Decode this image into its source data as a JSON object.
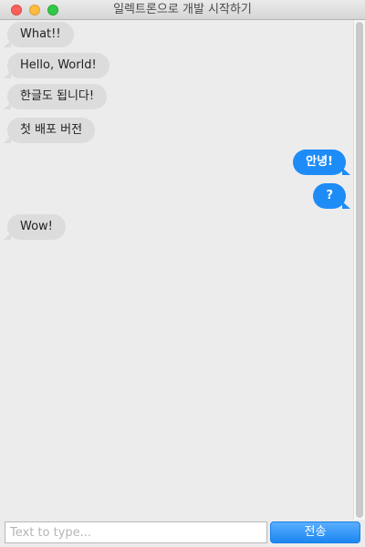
{
  "window": {
    "title": "일렉트론으로 개발 시작하기"
  },
  "messages": [
    {
      "direction": "received",
      "text": "What!!"
    },
    {
      "direction": "received",
      "text": "Hello, World!"
    },
    {
      "direction": "received",
      "text": "한글도 됩니다!"
    },
    {
      "direction": "received",
      "text": "첫 배포 버전"
    },
    {
      "direction": "sent",
      "text": "안녕!"
    },
    {
      "direction": "sent",
      "text": "?"
    },
    {
      "direction": "received",
      "text": "Wow!"
    }
  ],
  "composer": {
    "placeholder": "Text to type...",
    "value": "",
    "send_label": "전송"
  },
  "colors": {
    "sent_bubble": "#1e8cf7",
    "received_bubble": "#dcdcdc",
    "close": "#fc605c",
    "minimize": "#fdbc40",
    "maximize": "#34c84a"
  }
}
